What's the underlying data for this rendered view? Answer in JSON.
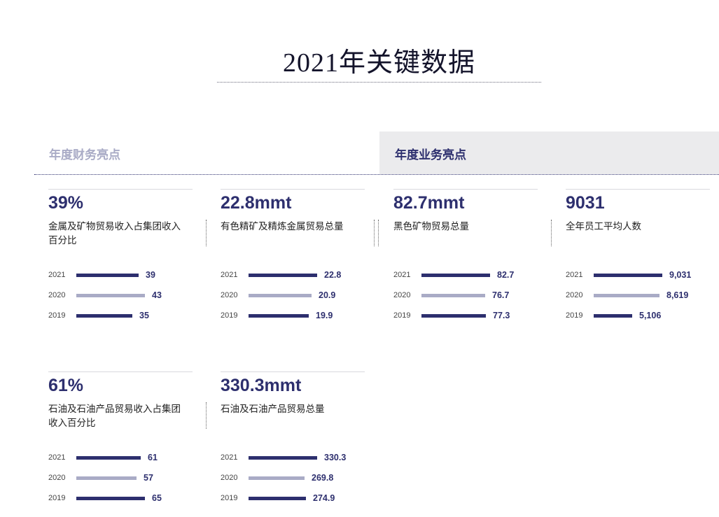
{
  "page_title": "2021年关键数据",
  "tabs": {
    "financial": "年度财务亮点",
    "business": "年度业务亮点"
  },
  "colors": {
    "dark_bar": "#2d2f6e",
    "light_bar": "#a9abc6",
    "accent_text": "#2d2f6e"
  },
  "cards": [
    {
      "big": "39%",
      "desc": "金属及矿物贸易收入占集团收入百分比",
      "rows": [
        {
          "year": "2021",
          "value": "39",
          "num": 39,
          "shade": "dark"
        },
        {
          "year": "2020",
          "value": "43",
          "num": 43,
          "shade": "light"
        },
        {
          "year": "2019",
          "value": "35",
          "num": 35,
          "shade": "dark"
        }
      ]
    },
    {
      "big": "22.8mmt",
      "desc": "有色精矿及精炼金属贸易总量",
      "rows": [
        {
          "year": "2021",
          "value": "22.8",
          "num": 22.8,
          "shade": "dark"
        },
        {
          "year": "2020",
          "value": "20.9",
          "num": 20.9,
          "shade": "light"
        },
        {
          "year": "2019",
          "value": "19.9",
          "num": 19.9,
          "shade": "dark"
        }
      ]
    },
    {
      "big": "82.7mmt",
      "desc": "黑色矿物贸易总量",
      "rows": [
        {
          "year": "2021",
          "value": "82.7",
          "num": 82.7,
          "shade": "dark"
        },
        {
          "year": "2020",
          "value": "76.7",
          "num": 76.7,
          "shade": "light"
        },
        {
          "year": "2019",
          "value": "77.3",
          "num": 77.3,
          "shade": "dark"
        }
      ]
    },
    {
      "big": "9031",
      "desc": "全年员工平均人数",
      "rows": [
        {
          "year": "2021",
          "value": "9,031",
          "num": 9031,
          "shade": "dark"
        },
        {
          "year": "2020",
          "value": "8,619",
          "num": 8619,
          "shade": "light"
        },
        {
          "year": "2019",
          "value": "5,106",
          "num": 5106,
          "shade": "dark"
        }
      ]
    },
    {
      "big": "61%",
      "desc": "石油及石油产品贸易收入占集团收入百分比",
      "rows": [
        {
          "year": "2021",
          "value": "61",
          "num": 61,
          "shade": "dark"
        },
        {
          "year": "2020",
          "value": "57",
          "num": 57,
          "shade": "light"
        },
        {
          "year": "2019",
          "value": "65",
          "num": 65,
          "shade": "dark"
        }
      ]
    },
    {
      "big": "330.3mmt",
      "desc": "石油及石油产品贸易总量",
      "rows": [
        {
          "year": "2021",
          "value": "330.3",
          "num": 330.3,
          "shade": "dark"
        },
        {
          "year": "2020",
          "value": "269.8",
          "num": 269.8,
          "shade": "light"
        },
        {
          "year": "2019",
          "value": "274.9",
          "num": 274.9,
          "shade": "dark"
        }
      ]
    }
  ]
}
